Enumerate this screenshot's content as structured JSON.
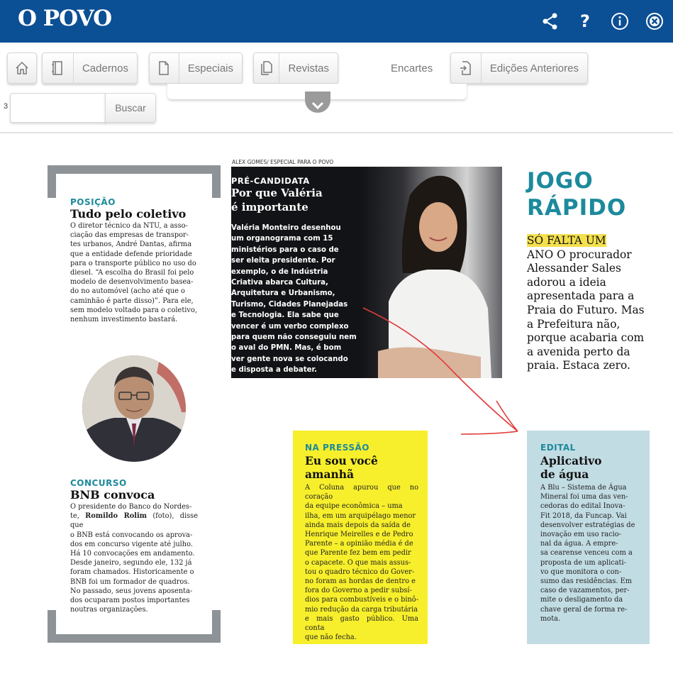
{
  "app": {
    "logo": "O POVO",
    "icons": [
      "share-icon",
      "help-icon",
      "info-icon",
      "close-icon"
    ]
  },
  "toolbar": {
    "cadernos": "Cadernos",
    "especiais": "Especiais",
    "revistas": "Revistas",
    "encartes": "Encartes",
    "edicoes": "Edições Anteriores",
    "search_value": "",
    "search_button": "Buscar",
    "page_indicator": "3"
  },
  "colors": {
    "brand": "#0b4f95",
    "accent": "#1c8a9c",
    "yellow": "#f7ef2b",
    "blue_box": "#c2dce3",
    "annotation_arrow": "#e23a3a"
  },
  "article": {
    "photo_credit": "ALEX GOMES/ ESPECIAL PARA O POVO",
    "posicao": {
      "kicker": "POSIÇÃO",
      "title": "Tudo pelo coletivo",
      "lines": [
        "O diretor técnico da NTU, a asso-",
        "ciação das empresas de transpor-",
        "tes urbanos, André Dantas, afirma",
        "que a entidade defende prioridade",
        "para o transporte público no uso do",
        "diesel. “A escolha do Brasil foi pelo",
        "modelo de desenvolvimento basea-",
        "do no automóvel (acho até que o",
        "caminhão é parte disso)”. Para ele,",
        "sem modelo voltado para o coletivo,",
        "nenhum investimento bastará."
      ]
    },
    "concurso": {
      "kicker": "CONCURSO",
      "title": "BNB convoca",
      "intro": "O presidente do Banco do Nordes-",
      "name_pre": "te, ",
      "name_bold": "Romildo Rolim",
      "name_post": " (foto), disse que",
      "lines": [
        "o BNB está convocando os aprova-",
        "dos em concurso vigente até julho.",
        "Há 10 convocações em andamento.",
        "Desde janeiro, segundo ele, 132 já",
        "foram chamados. Historicamente o",
        "BNB foi um formador de quadros.",
        "No passado, seus jovens aposenta-",
        "dos ocuparam postos importantes",
        "noutras organizações."
      ]
    },
    "precandidata": {
      "kicker": "PRÉ-CANDIDATA",
      "title_1": "Por que Valéria",
      "title_2": "é importante",
      "lines": [
        "Valéria Monteiro desenhou",
        "um organograma com 15",
        "ministérios para o caso de",
        "ser eleita presidente. Por",
        "exemplo, o de Indústria",
        "Criativa abarca Cultura,",
        "Arquitetura e Urbanismo,",
        "Turismo, Cidades Planejadas",
        "e Tecnologia. Ela sabe que",
        "vencer é um verbo complexo",
        "para quem não conseguiu nem",
        "o aval do PMN. Mas, é bom",
        "ver gente nova se colocando",
        "e disposta a debater."
      ]
    },
    "jogo_rapido": {
      "title_1": "JOGO",
      "title_2": "RÁPIDO",
      "highlight": "SÓ FALTA UM",
      "lines": [
        "ANO O procurador",
        "Alessander Sales",
        "adorou a ideia",
        "apresentada para a",
        "Praia do Futuro. Mas",
        "a Prefeitura não,",
        "porque acabaria com",
        "a avenida perto da",
        "praia. Estaca zero."
      ]
    },
    "na_pressao": {
      "kicker": "NA PRESSÃO",
      "title_1": "Eu sou você",
      "title_2": "amanhã",
      "lines": [
        "A Coluna apurou que no coração",
        "da equipe econômica – uma",
        "ilha, em um arquipélago menor",
        "ainda mais depois da saída de",
        "Henrique Meirelles e de Pedro",
        "Parente – a opinião média é de",
        "que Parente fez bem em pedir",
        "o capacete. O que mais assus-",
        "tou o quadro técnico do Gover-",
        "no foram as hordas de dentro e",
        "fora do Governo a pedir subsí-",
        "dios para combustíveis e o binô-",
        "mio redução da carga tributária",
        "e mais gasto público. Uma conta",
        "que não fecha."
      ]
    },
    "edital": {
      "kicker": "EDITAL",
      "title_1": "Aplicativo",
      "title_2": "de água",
      "lines": [
        "A Blu – Sistema de Água",
        "Mineral foi uma das ven-",
        "cedoras do edital Inova-",
        "Fit 2018, da Funcap. Vai",
        "desenvolver estratégias de",
        "inovação em uso racio-",
        "nal da água. A empre-",
        "sa cearense venceu com a",
        "proposta de um aplicati-",
        "vo que monitora o con-",
        "sumo das residências. Em",
        "caso de vazamentos, per-",
        "mite o desligamento da",
        "chave geral de forma re-",
        "mota."
      ]
    }
  }
}
